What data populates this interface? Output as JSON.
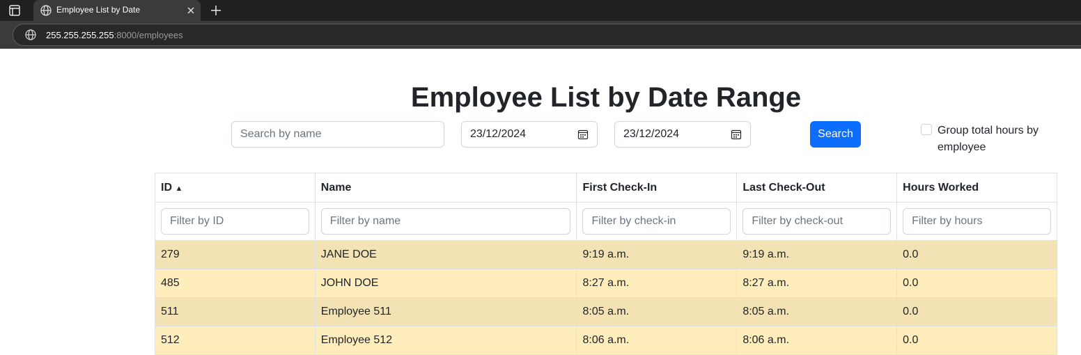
{
  "browser": {
    "tab_title": "Employee List by Date",
    "url_host": "255.255.255.255",
    "url_rest": ":8000/employees"
  },
  "page": {
    "title": "Employee List by Date Range"
  },
  "search": {
    "placeholder": "Search by name",
    "start_date": "23/12/2024",
    "end_date": "23/12/2024",
    "button_label": "Search",
    "group_label": "Group total hours by employee",
    "group_checked": false
  },
  "table": {
    "columns": [
      {
        "label": "ID",
        "sort_indicator": "▲"
      },
      {
        "label": "Name"
      },
      {
        "label": "First Check-In"
      },
      {
        "label": "Last Check-Out"
      },
      {
        "label": "Hours Worked"
      }
    ],
    "filters": [
      "Filter by ID",
      "Filter by name",
      "Filter by check-in",
      "Filter by check-out",
      "Filter by hours"
    ],
    "rows": [
      {
        "id": "279",
        "name": "JANE DOE",
        "check_in": "9:19 a.m.",
        "check_out": "9:19 a.m.",
        "hours": "0.0"
      },
      {
        "id": "485",
        "name": "JOHN DOE",
        "check_in": "8:27 a.m.",
        "check_out": "8:27 a.m.",
        "hours": "0.0"
      },
      {
        "id": "511",
        "name": "Employee 511",
        "check_in": "8:05 a.m.",
        "check_out": "8:05 a.m.",
        "hours": "0.0"
      },
      {
        "id": "512",
        "name": "Employee 512",
        "check_in": "8:06 a.m.",
        "check_out": "8:06 a.m.",
        "hours": "0.0"
      }
    ],
    "row_colors": [
      "#f3e2b3",
      "#ffeebb"
    ]
  },
  "icons": {
    "tab_strip": "tab-strip-icon",
    "tab_favicon": "globe-icon",
    "close": "close-icon",
    "new_tab": "plus-icon",
    "site_info": "globe-icon",
    "date_picker": "calendar-icon"
  },
  "colors": {
    "primary": "#0d6efd",
    "chrome_dark": "#202020",
    "chrome_toolbar": "#3b3b3b"
  }
}
